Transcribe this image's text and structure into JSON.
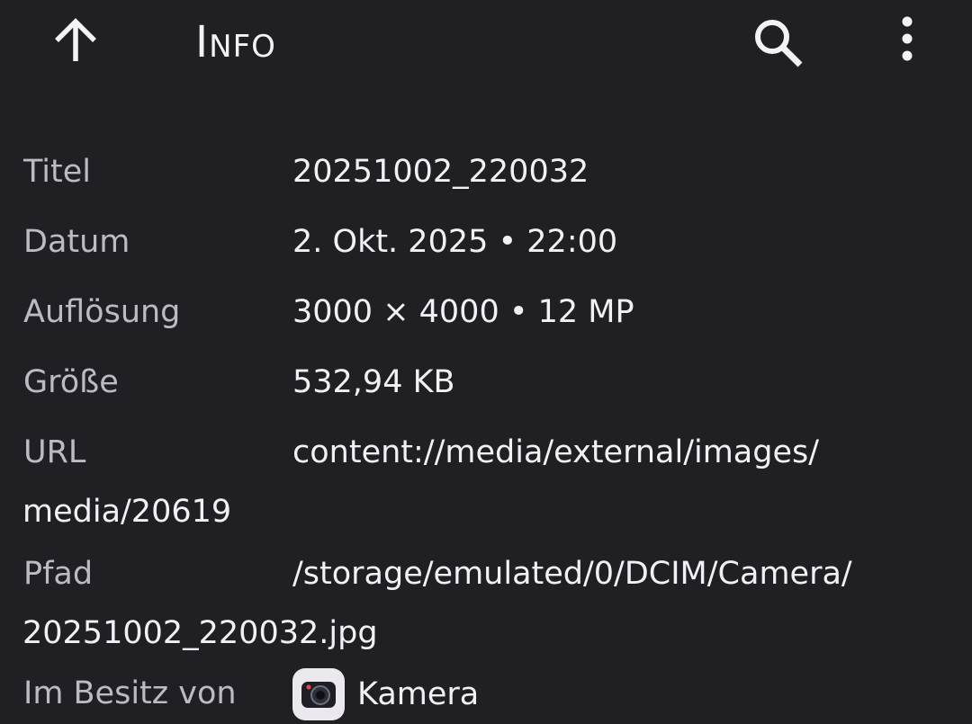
{
  "header": {
    "title": "Info",
    "back_icon": "arrow-up-icon",
    "search_icon": "search-icon",
    "more_icon": "more-vert-icon"
  },
  "details": {
    "title": {
      "label": "Titel",
      "value": "20251002_220032"
    },
    "date": {
      "label": "Datum",
      "value": "2. Okt. 2025 • 22:00"
    },
    "resolution": {
      "label": "Auflösung",
      "value": "3000 × 4000 • 12 MP"
    },
    "size": {
      "label": "Größe",
      "value": "532,94 KB"
    },
    "url": {
      "label": "URL",
      "value_line1": "content://media/external/images/",
      "value_line2": "media/20619"
    },
    "path": {
      "label": "Pfad",
      "value_line1": "/storage/emulated/0/DCIM/Camera/",
      "value_line2": "20251002_220032.jpg"
    },
    "owner": {
      "label": "Im Besitz von",
      "value": "Kamera",
      "icon": "camera-app-icon"
    }
  },
  "colors": {
    "background": "#201f24",
    "label_text": "#bdbac4",
    "value_text": "#f2f0f5"
  }
}
